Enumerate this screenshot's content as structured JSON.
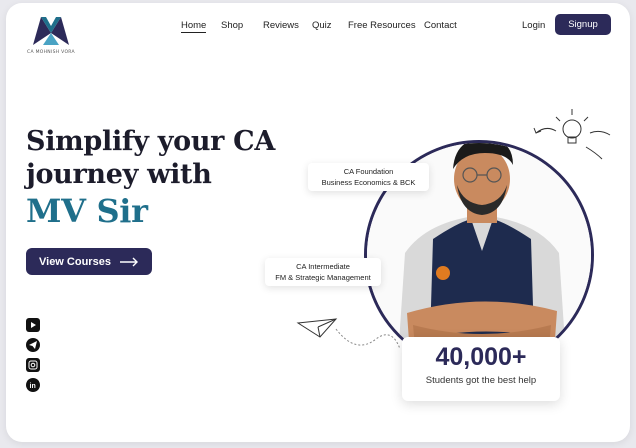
{
  "brand": {
    "name": "CA MOHNISH VORA",
    "color": "#2c2a59",
    "accent": "#1f6f8b"
  },
  "nav": {
    "items": [
      "Home",
      "Shop",
      "Reviews",
      "Quiz",
      "Free Resources",
      "Contact"
    ],
    "active": "Home"
  },
  "auth": {
    "login": "Login",
    "signup": "Signup"
  },
  "hero": {
    "line1": "Simplify your CA",
    "line2": "journey with",
    "accent": "MV Sir",
    "cta": "View Courses",
    "cta_icon": "arrow-right-icon"
  },
  "socials": [
    "youtube-icon",
    "telegram-icon",
    "instagram-icon",
    "linkedin-icon"
  ],
  "tags": {
    "foundation_line1": "CA Foundation",
    "foundation_line2": "Business Economics & BCK",
    "intermediate_line1": "CA Intermediate",
    "intermediate_line2": "FM & Strategic Management"
  },
  "stats": {
    "number": "40,000+",
    "label": "Students got the best help"
  }
}
